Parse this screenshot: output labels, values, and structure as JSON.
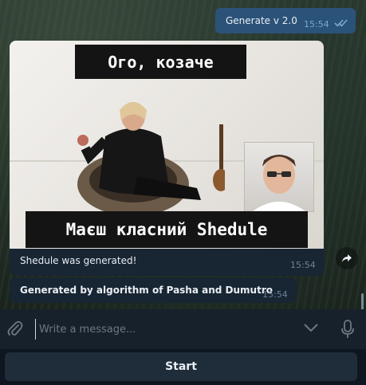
{
  "chat": {
    "outgoing": {
      "text": "Generate v 2.0",
      "time": "15:54",
      "status": "read"
    },
    "image_message": {
      "meme_top_text": "Ого, козаче",
      "meme_bottom_text": "Маєш класний Shedule",
      "caption": "Shedule was generated!",
      "time": "15:54"
    },
    "text_message": {
      "text": "Generated by algorithm of Pasha and Dumutro",
      "time": "15:54"
    }
  },
  "composer": {
    "placeholder": "Write a message...",
    "value": ""
  },
  "keyboard": {
    "button_label": "Start"
  },
  "colors": {
    "outgoing_bubble": "#2b5278",
    "incoming_bubble": "#182533",
    "panel": "#17212b",
    "accent_checks": "#7da8d3"
  },
  "icons": {
    "read_receipt": "double-check-icon",
    "share": "share-arrow-icon",
    "attach": "paperclip-icon",
    "expand": "chevron-down-icon",
    "voice": "microphone-icon"
  }
}
